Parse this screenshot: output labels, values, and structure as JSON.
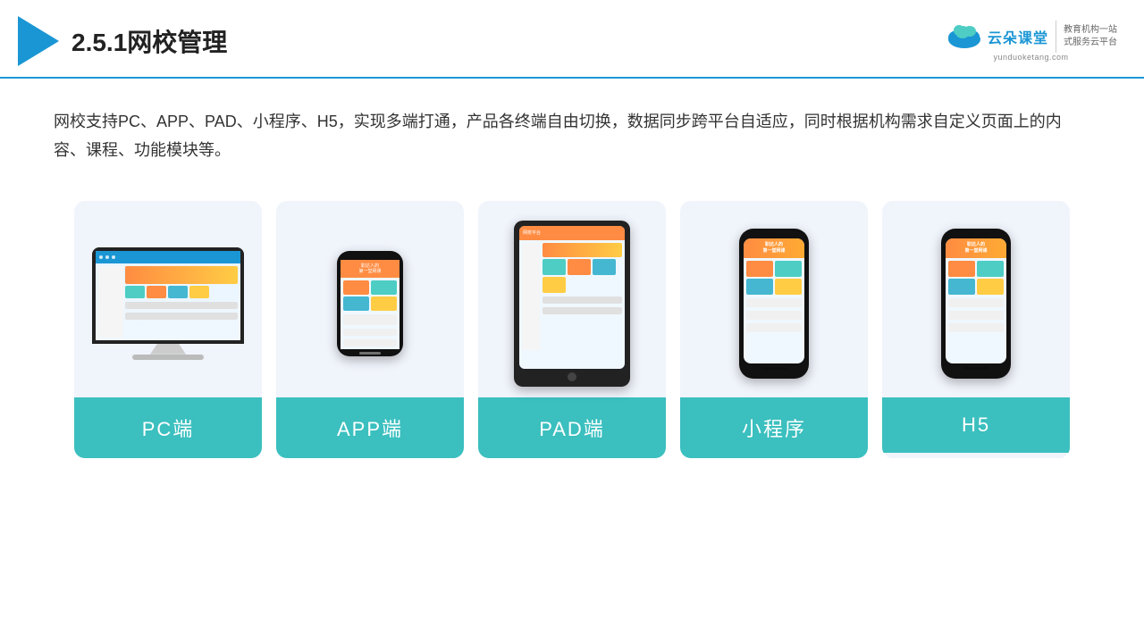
{
  "header": {
    "title": "2.5.1网校管理",
    "brand": {
      "name_cn": "云朵课堂",
      "name_en": "yunduoketang.com",
      "tagline_line1": "教育机构一站",
      "tagline_line2": "式服务云平台"
    }
  },
  "description": "网校支持PC、APP、PAD、小程序、H5，实现多端打通，产品各终端自由切换，数据同步跨平台自适应，同时根据机构需求自定义页面上的内容、课程、功能模块等。",
  "cards": [
    {
      "id": "pc",
      "label": "PC端"
    },
    {
      "id": "app",
      "label": "APP端"
    },
    {
      "id": "pad",
      "label": "PAD端"
    },
    {
      "id": "miniapp",
      "label": "小程序"
    },
    {
      "id": "h5",
      "label": "H5"
    }
  ]
}
